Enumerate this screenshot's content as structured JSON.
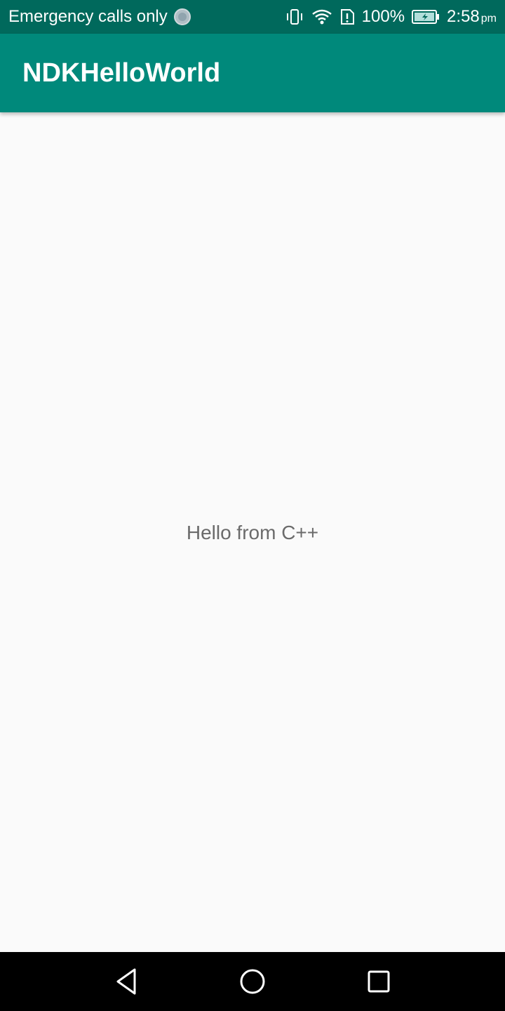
{
  "status_bar": {
    "carrier_text": "Emergency calls only",
    "battery_percent": "100%",
    "time": "2:58",
    "ampm": "pm",
    "icons": [
      "spinner-icon",
      "vibrate-icon",
      "wifi-icon",
      "alert-sim-icon",
      "battery-charging-icon"
    ]
  },
  "app_bar": {
    "title": "NDKHelloWorld",
    "color": "#00897b"
  },
  "main": {
    "message": "Hello from C++"
  },
  "nav_bar": {
    "buttons": [
      "back-icon",
      "home-icon",
      "recents-icon"
    ]
  }
}
